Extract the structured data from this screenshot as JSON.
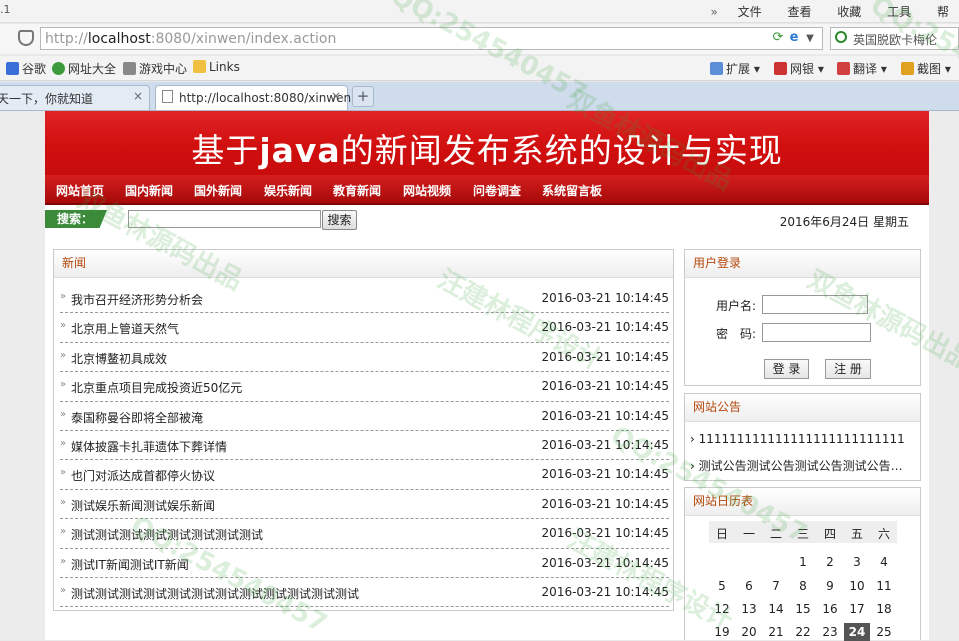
{
  "browser": {
    "menu_left": ".1",
    "menu_items": [
      "»",
      "文件",
      "查看",
      "收藏",
      "工具",
      "帮"
    ],
    "url_gray_prefix": "http://",
    "url_host": "localhost",
    "url_rest": ":8080/xinwen/index.action",
    "search_box_text": "英国脱欧卡梅伦",
    "bookmarks": [
      "谷歌",
      "网址大全",
      "游戏中心",
      "Links"
    ],
    "right_tools": [
      "扩展",
      "网银",
      "翻译",
      "截图"
    ],
    "tabs": [
      {
        "title": "天一下，你就知道",
        "close": "×"
      },
      {
        "title": "http://localhost:8080/xinwen",
        "close": "×"
      }
    ],
    "new_tab": "+"
  },
  "site": {
    "banner_pre": "基于",
    "banner_java": "java",
    "banner_post": "的新闻发布系统的设计与实现",
    "nav": [
      "网站首页",
      "国内新闻",
      "国外新闻",
      "娱乐新闻",
      "教育新闻",
      "网站视频",
      "问卷调查",
      "系统留言板"
    ],
    "search_label": "搜索：",
    "search_button": "搜索",
    "date": "2016年6月24日  星期五"
  },
  "news": {
    "title": "新闻",
    "marker": "»",
    "items": [
      {
        "title": "我市召开经济形势分析会",
        "date": "2016-03-21 10:14:45"
      },
      {
        "title": "北京用上管道天然气",
        "date": "2016-03-21 10:14:45"
      },
      {
        "title": "北京博鳌初具成效",
        "date": "2016-03-21 10:14:45"
      },
      {
        "title": "北京重点项目完成投资近50亿元",
        "date": "2016-03-21 10:14:45"
      },
      {
        "title": "泰国称曼谷即将全部被淹",
        "date": "2016-03-21 10:14:45"
      },
      {
        "title": "媒体披露卡扎菲遗体下葬详情",
        "date": "2016-03-21 10:14:45"
      },
      {
        "title": "也门对派达成首都停火协议",
        "date": "2016-03-21 10:14:45"
      },
      {
        "title": "测试娱乐新闻测试娱乐新闻",
        "date": "2016-03-21 10:14:45"
      },
      {
        "title": "测试测试测试测试测试测试测试测试",
        "date": "2016-03-21 10:14:45"
      },
      {
        "title": "测试IT新闻测试IT新闻",
        "date": "2016-03-21 10:14:45"
      },
      {
        "title": "测试测试测试测试测试测试测试测试测试测试测试测试",
        "date": "2016-03-21 10:14:45"
      }
    ]
  },
  "login": {
    "title": "用户登录",
    "username_label": "用户名:",
    "password_label": "密　码:",
    "login_button": "登 录",
    "register_button": "注 册"
  },
  "notice": {
    "title": "网站公告",
    "items": [
      "111111111111111111111111111",
      "测试公告测试公告测试公告测试公告…"
    ]
  },
  "calendar": {
    "title": "网站日历表",
    "weekdays": [
      "日",
      "一",
      "二",
      "三",
      "四",
      "五",
      "六"
    ],
    "weeks": [
      [
        "",
        "",
        "",
        "1",
        "2",
        "3",
        "4"
      ],
      [
        "5",
        "6",
        "7",
        "8",
        "9",
        "10",
        "11"
      ],
      [
        "12",
        "13",
        "14",
        "15",
        "16",
        "17",
        "18"
      ],
      [
        "19",
        "20",
        "21",
        "22",
        "23",
        "24",
        "25"
      ]
    ],
    "today": "24"
  },
  "watermark": [
    "QQ:254540457",
    "双鱼林源码出品",
    "汪建林程序设计"
  ],
  "colors": {
    "banner_red": "#d10f0f",
    "nav_dark_red": "#a70909",
    "box_title": "#b5470c",
    "search_label_green": "#3a8a3a"
  }
}
